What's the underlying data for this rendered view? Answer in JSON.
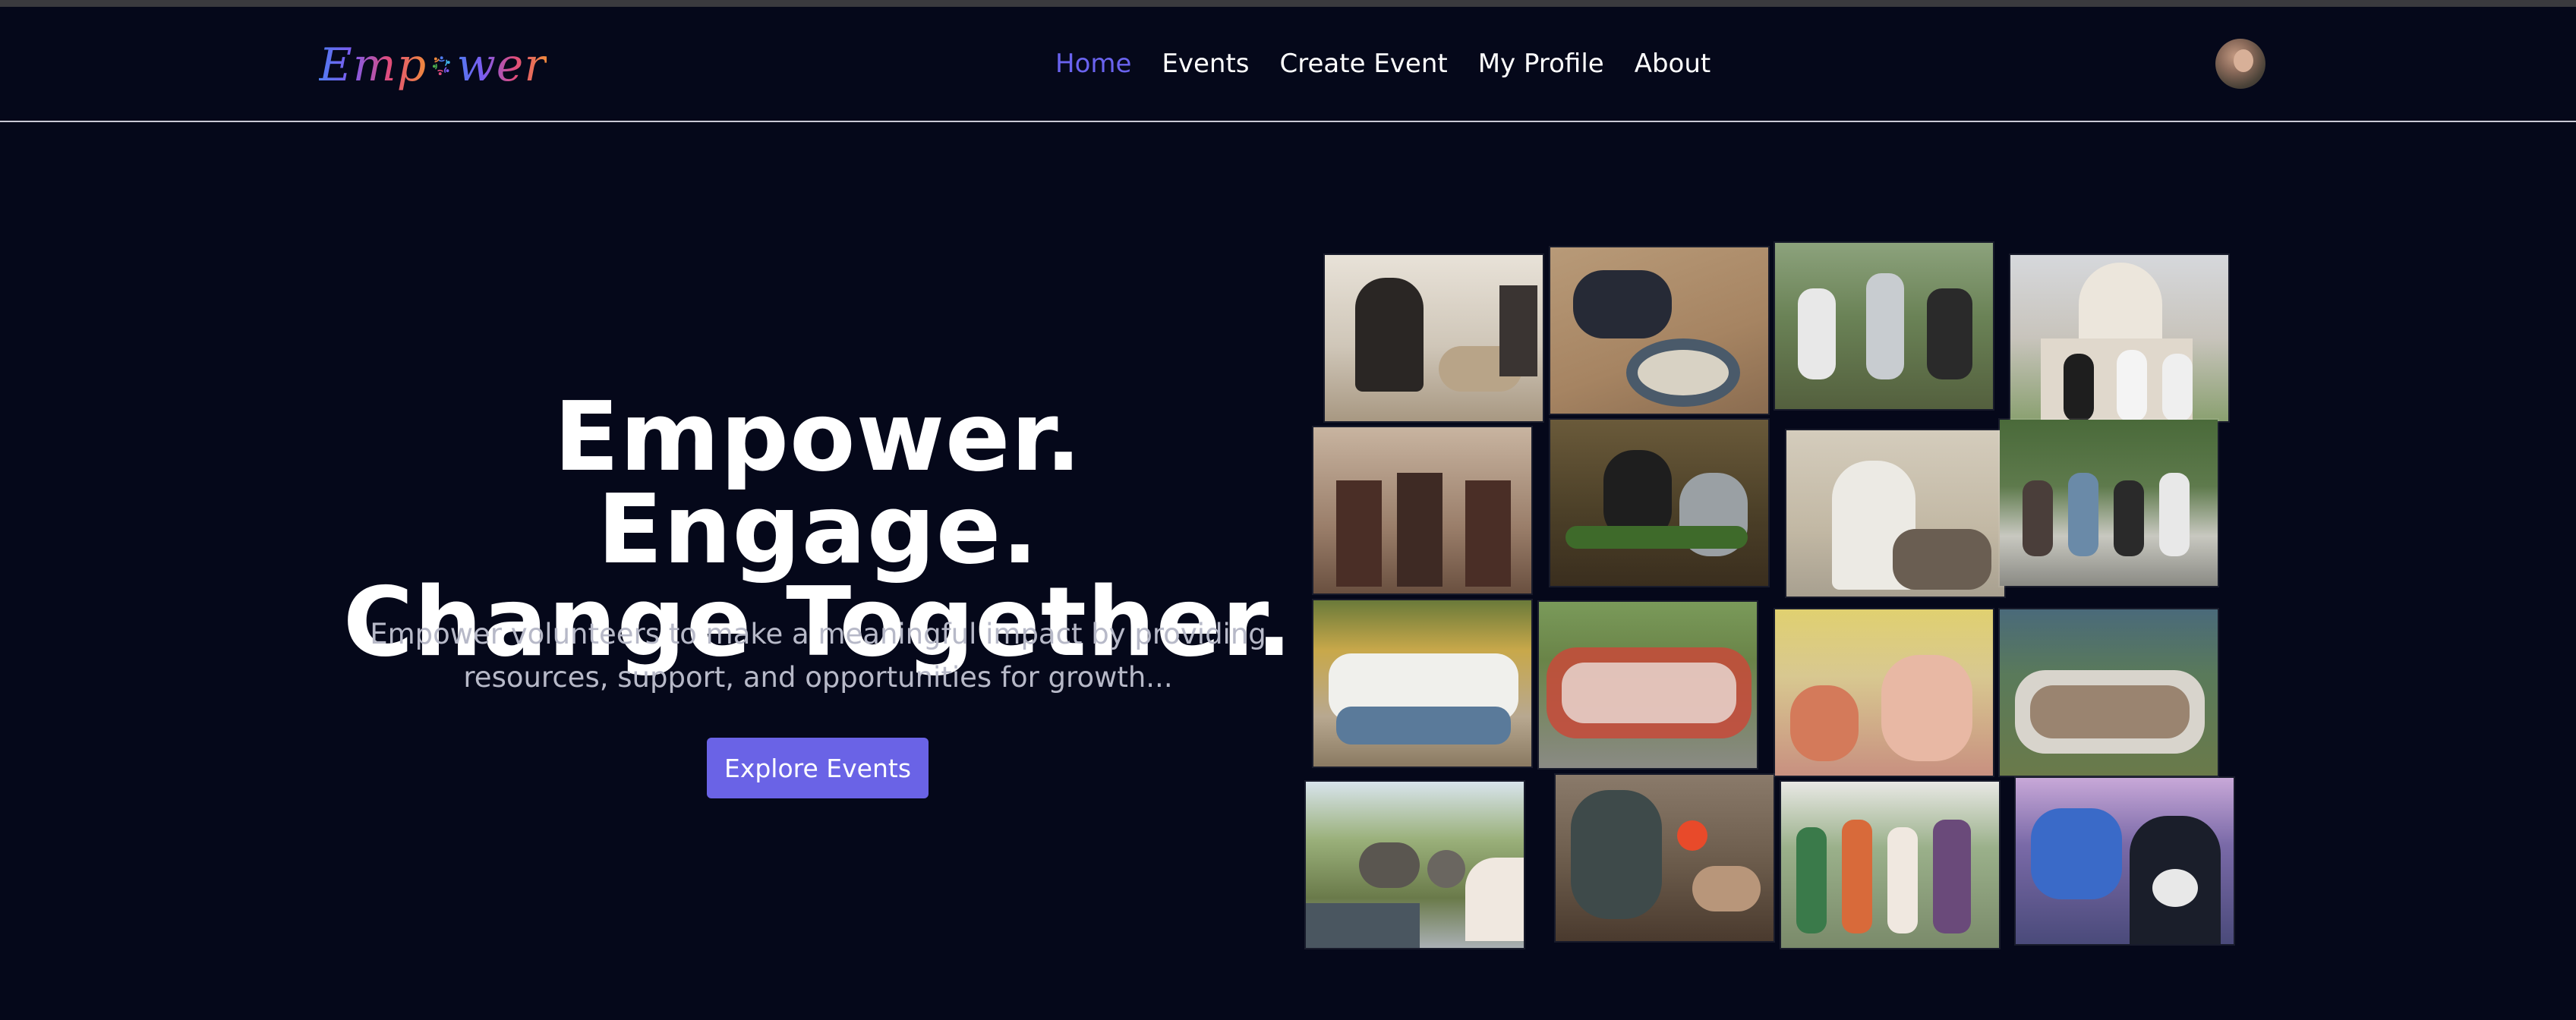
{
  "app": {
    "logo": {
      "text_left": "Emp",
      "text_right": "wer",
      "mark_icon": "people-circle-icon"
    }
  },
  "nav": {
    "items": [
      {
        "label": "Home",
        "active": true
      },
      {
        "label": "Events",
        "active": false
      },
      {
        "label": "Create Event",
        "active": false
      },
      {
        "label": "My Profile",
        "active": false
      },
      {
        "label": "About",
        "active": false
      }
    ],
    "active_color": "#6a63ef"
  },
  "user": {
    "avatar_icon": "user-avatar"
  },
  "hero": {
    "title_line1": "Empower. Engage.",
    "title_line2": "Change Together.",
    "subtitle_line1": "Empower volunteers to make a meaningful impact by providing",
    "subtitle_line2": "resources, support, and opportunities for growth...",
    "cta_label": "Explore Events",
    "cta_color": "#6a63e6"
  },
  "gallery": {
    "photo_count": 16
  },
  "colors": {
    "background": "#05081a",
    "nav_border": "#c9c9d6",
    "subtitle": "#b7b9c8"
  }
}
